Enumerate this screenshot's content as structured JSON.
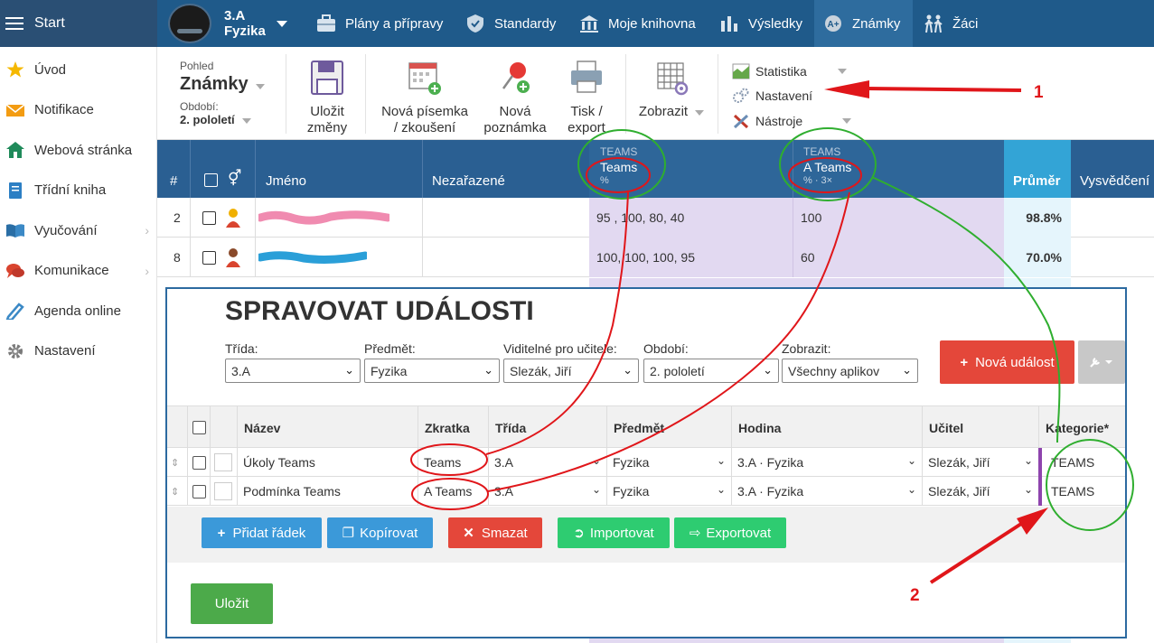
{
  "topbar": {
    "start_label": "Start",
    "class_line1": "3.A",
    "class_line2": "Fyzika",
    "nav": [
      {
        "label": "Plány a přípravy",
        "icon": "briefcase-icon"
      },
      {
        "label": "Standardy",
        "icon": "shield-icon"
      },
      {
        "label": "Moje knihovna",
        "icon": "library-icon"
      },
      {
        "label": "Výsledky",
        "icon": "bar-chart-icon"
      },
      {
        "label": "Známky",
        "icon": "grade-icon"
      },
      {
        "label": "Žáci",
        "icon": "students-icon"
      }
    ]
  },
  "sidebar": {
    "items": [
      {
        "label": "Úvod",
        "icon": "star-icon"
      },
      {
        "label": "Notifikace",
        "icon": "envelope-icon"
      },
      {
        "label": "Webová stránka",
        "icon": "home-icon"
      },
      {
        "label": "Třídní kniha",
        "icon": "book-icon"
      },
      {
        "label": "Vyučování",
        "icon": "open-book-icon"
      },
      {
        "label": "Komunikace",
        "icon": "chat-icon"
      },
      {
        "label": "Agenda online",
        "icon": "pencil-icon"
      },
      {
        "label": "Nastavení",
        "icon": "gear-icon"
      }
    ]
  },
  "toolbar": {
    "view_label": "Pohled",
    "view_value": "Známky",
    "period_label": "Období:",
    "period_value": "2. pololetí",
    "save_line1": "Uložit",
    "save_line2": "změny",
    "new_test_line1": "Nová písemka",
    "new_test_line2": "/ zkoušení",
    "new_note_line1": "Nová",
    "new_note_line2": "poznámka",
    "print_line1": "Tisk /",
    "print_line2": "export",
    "display_label": "Zobrazit",
    "menu_statistics": "Statistika",
    "menu_settings": "Nastavení",
    "menu_tools": "Nástroje"
  },
  "grades_table": {
    "headers": {
      "num": "#",
      "name": "Jméno",
      "unassigned": "Nezařazené",
      "col1_cat": "TEAMS",
      "col1_name": "Teams",
      "col1_sub": "%",
      "col2_cat": "TEAMS",
      "col2_name": "A Teams",
      "col2_sub": "% · 3×",
      "average": "Průměr",
      "report": "Vysvědčení"
    },
    "rows": [
      {
        "num": "2",
        "col1": "95 , 100, 80, 40",
        "col2": "100",
        "average": "98.8%"
      },
      {
        "num": "8",
        "col1": "100, 100, 100, 95",
        "col2": "60",
        "average": "70.0%"
      }
    ]
  },
  "dialog": {
    "title": "SPRAVOVAT UDÁLOSTI",
    "filters": [
      {
        "label": "Třída:",
        "value": "3.A"
      },
      {
        "label": "Předmět:",
        "value": "Fyzika"
      },
      {
        "label": "Viditelné pro učitele:",
        "value": "Slezák, Jiří"
      },
      {
        "label": "Období:",
        "value": "2. pololetí"
      },
      {
        "label": "Zobrazit:",
        "value": "Všechny aplikov"
      }
    ],
    "new_event_label": "Nová událost",
    "columns": [
      "Název",
      "Zkratka",
      "Třída",
      "Předmět",
      "Hodina",
      "Učitel",
      "Kategorie*"
    ],
    "rows": [
      {
        "name": "Úkoly Teams",
        "abbr": "Teams",
        "class": "3.A",
        "subject": "Fyzika",
        "lesson": "3.A · Fyzika",
        "teacher": "Slezák, Jiří",
        "category": "TEAMS"
      },
      {
        "name": "Podmínka Teams",
        "abbr": "A Teams",
        "class": "3.A",
        "subject": "Fyzika",
        "lesson": "3.A · Fyzika",
        "teacher": "Slezák, Jiří",
        "category": "TEAMS"
      }
    ],
    "buttons": {
      "add_row": "Přidat řádek",
      "copy": "Kopírovat",
      "delete": "Smazat",
      "import": "Importovat",
      "export": "Exportovat",
      "save": "Uložit"
    }
  },
  "annotations": {
    "label1": "1",
    "label2": "2"
  },
  "colors": {
    "topbar": "#1f5a8a",
    "header": "#2a5f92",
    "purple_cells": "#e2d9f1",
    "average_cells": "#e5f5fc",
    "new_event": "#e4473a",
    "add_row": "#3b99d9",
    "delete": "#e4473a",
    "import_export": "#2ecc71",
    "save": "#4caa4a",
    "annotation_red": "#e0161a",
    "annotation_green": "#2fae2f"
  }
}
